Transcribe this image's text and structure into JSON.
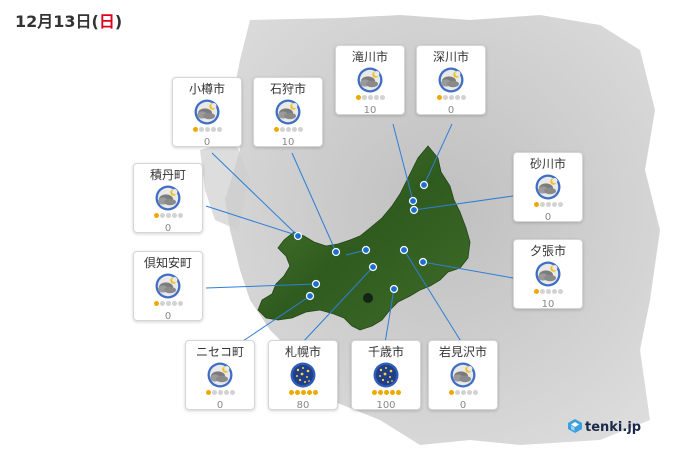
{
  "header": {
    "date_main": "12月13日",
    "paren_open": "(",
    "weekday": "日",
    "paren_close": ")"
  },
  "colors": {
    "sunday": "#e0001b",
    "line": "#2e7fd6",
    "marker": "#1a6fd0",
    "index_on": "#f0a800",
    "index_off": "#d2d2d2"
  },
  "cities": [
    {
      "name": "小樽市",
      "value": "0",
      "level": 1,
      "icon": "cloud-moon-icon"
    },
    {
      "name": "石狩市",
      "value": "10",
      "level": 1,
      "icon": "cloud-moon-icon"
    },
    {
      "name": "滝川市",
      "value": "10",
      "level": 1,
      "icon": "cloud-moon-icon"
    },
    {
      "name": "深川市",
      "value": "0",
      "level": 1,
      "icon": "cloud-moon-icon"
    },
    {
      "name": "積丹町",
      "value": "0",
      "level": 1,
      "icon": "cloud-moon-icon"
    },
    {
      "name": "砂川市",
      "value": "0",
      "level": 1,
      "icon": "cloud-moon-icon"
    },
    {
      "name": "倶知安町",
      "value": "0",
      "level": 1,
      "icon": "cloud-moon-icon"
    },
    {
      "name": "夕張市",
      "value": "10",
      "level": 1,
      "icon": "cloud-moon-icon"
    },
    {
      "name": "ニセコ町",
      "value": "0",
      "level": 1,
      "icon": "cloud-moon-icon"
    },
    {
      "name": "札幌市",
      "value": "80",
      "level": 5,
      "icon": "starry-night-icon"
    },
    {
      "name": "千歳市",
      "value": "100",
      "level": 5,
      "icon": "starry-night-icon"
    },
    {
      "name": "岩見沢市",
      "value": "0",
      "level": 1,
      "icon": "cloud-moon-icon"
    }
  ],
  "logo": {
    "text": "tenki.jp",
    "icon": "tenki-logo-icon"
  }
}
